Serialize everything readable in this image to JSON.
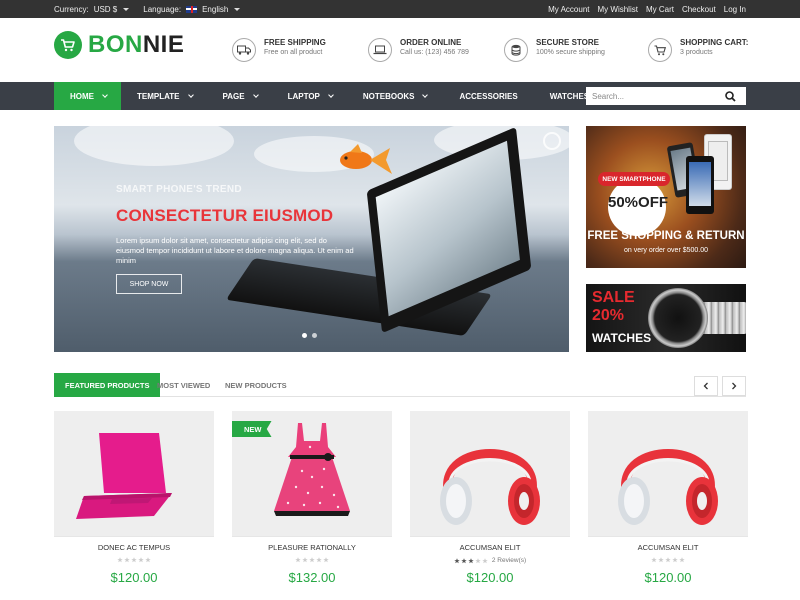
{
  "topbar": {
    "currency_label": "Currency:",
    "currency_value": "USD $",
    "language_label": "Language:",
    "language_value": "English",
    "links": [
      "My Account",
      "My Wishlist",
      "My Cart",
      "Checkout",
      "Log In"
    ]
  },
  "header": {
    "logo_green": "BON",
    "logo_dark": "NIE",
    "info": [
      {
        "title": "FREE SHIPPING",
        "sub": "Free on all product",
        "icon": "truck-icon"
      },
      {
        "title": "ORDER ONLINE",
        "sub": "Call us: (123) 456 789",
        "icon": "laptop-icon"
      },
      {
        "title": "SECURE STORE",
        "sub": "100% secure shipping",
        "icon": "database-icon"
      },
      {
        "title": "SHOPPING CART:",
        "sub": "3 products",
        "icon": "cart-icon"
      }
    ]
  },
  "nav": {
    "items": [
      "HOME",
      "TEMPLATE",
      "PAGE",
      "LAPTOP",
      "NOTEBOOKS",
      "ACCESSORIES",
      "WATCHES"
    ],
    "search_placeholder": "Search..."
  },
  "slider": {
    "subtitle": "SMART PHONE'S TREND",
    "title": "CONSECTETUR EIUSMOD",
    "desc": "Lorem ipsum dolor sit amet, consectetur adipisi cing elit, sed do eiusmod tempor incididunt ut labore et dolore magna aliqua. Ut enim ad minim",
    "button": "SHOP NOW"
  },
  "banner1": {
    "tag": "NEW SMARTPHONE",
    "discount": "50%OFF",
    "headline": "FREE SHOPPING & RETURN",
    "sub": "on very order over $500.00"
  },
  "banner2": {
    "sale": "SALE",
    "percent": "20%",
    "label": "WATCHES"
  },
  "tabs": {
    "items": [
      "FEATURED PRODUCTS",
      "MOST VIEWED",
      "NEW PRODUCTS"
    ],
    "prev_icon": "chevron-left-icon",
    "next_icon": "chevron-right-icon"
  },
  "products": [
    {
      "name": "DONEC AC TEMPUS",
      "price": "$120.00",
      "rating": 0,
      "reviews": "",
      "badge": ""
    },
    {
      "name": "PLEASURE RATIONALLY",
      "price": "$132.00",
      "rating": 0,
      "reviews": "",
      "badge": "NEW"
    },
    {
      "name": "ACCUMSAN ELIT",
      "price": "$120.00",
      "rating": 3,
      "reviews": "2 Review(s)",
      "badge": ""
    },
    {
      "name": "ACCUMSAN ELIT",
      "price": "$120.00",
      "rating": 0,
      "reviews": "",
      "badge": ""
    }
  ],
  "colors": {
    "accent": "#27a844",
    "topbar": "#333333",
    "nav": "#3a3f47",
    "slide_title": "#e8353a"
  }
}
